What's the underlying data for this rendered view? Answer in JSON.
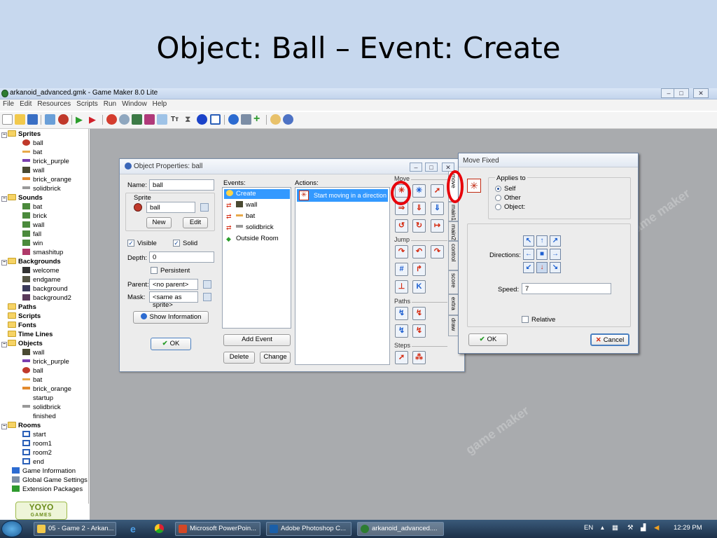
{
  "slide": {
    "title": "Object: Ball – Event: Create"
  },
  "window": {
    "title": "arkanoid_advanced.gmk - Game Maker 8.0 Lite",
    "menus": [
      "File",
      "Edit",
      "Resources",
      "Scripts",
      "Run",
      "Window",
      "Help"
    ],
    "controls": [
      "minimize",
      "maximize",
      "close"
    ]
  },
  "toolbar": {
    "icons": [
      "new-file-icon",
      "open-folder-icon",
      "save-icon",
      "create-exe-icon",
      "publish-icon",
      "run-icon",
      "run-debug-icon",
      "add-sprite-icon",
      "add-sound-icon",
      "add-background-icon",
      "add-path-icon",
      "add-script-icon",
      "add-font-icon",
      "add-timeline-icon",
      "add-object-icon",
      "add-room-icon",
      "game-information-icon",
      "global-settings-icon",
      "extension-packages-icon",
      "manual-icon",
      "help-icon"
    ]
  },
  "tree": {
    "sprites": {
      "label": "Sprites",
      "items": [
        "ball",
        "bat",
        "brick_purple",
        "wall",
        "brick_orange",
        "solidbrick"
      ]
    },
    "sounds": {
      "label": "Sounds",
      "items": [
        "bat",
        "brick",
        "wall",
        "fall",
        "win",
        "smashitup"
      ]
    },
    "backgrounds": {
      "label": "Backgrounds",
      "items": [
        "welcome",
        "endgame",
        "background",
        "background2"
      ]
    },
    "paths": "Paths",
    "scripts": "Scripts",
    "fonts": "Fonts",
    "timelines": "Time Lines",
    "objects": {
      "label": "Objects",
      "items": [
        "wall",
        "brick_purple",
        "ball",
        "bat",
        "brick_orange",
        "startup",
        "solidbrick",
        "finished"
      ]
    },
    "rooms": {
      "label": "Rooms",
      "items": [
        "start",
        "room1",
        "room2",
        "end"
      ]
    },
    "extras": [
      "Game Information",
      "Global Game Settings",
      "Extension Packages"
    ]
  },
  "logo": {
    "main": "YOYO",
    "sub": "GAMES"
  },
  "object_properties": {
    "title": "Object Properties: ball",
    "name_label": "Name:",
    "name_value": "ball",
    "sprite_label": "Sprite",
    "sprite_value": "ball",
    "new_button": "New",
    "edit_button": "Edit",
    "visible_label": "Visible",
    "visible_checked": true,
    "solid_label": "Solid",
    "solid_checked": true,
    "depth_label": "Depth:",
    "depth_value": "0",
    "persistent_label": "Persistent",
    "persistent_checked": false,
    "parent_label": "Parent:",
    "parent_value": "<no parent>",
    "mask_label": "Mask:",
    "mask_value": "<same as sprite>",
    "show_info_button": "Show Information",
    "ok_button": "OK",
    "events_label": "Events:",
    "events": [
      "Create",
      "wall",
      "bat",
      "solidbrick",
      "Outside Room"
    ],
    "selected_event": "Create",
    "add_event_button": "Add Event",
    "delete_button": "Delete",
    "change_button": "Change",
    "actions_label": "Actions:",
    "actions": [
      "Start moving in a direction"
    ]
  },
  "palette": {
    "groups": [
      "Move",
      "Jump",
      "Paths",
      "Steps"
    ],
    "tabs": [
      "move",
      "main1",
      "main2",
      "control",
      "score",
      "extra",
      "draw"
    ],
    "active_tab": "move"
  },
  "move_fixed": {
    "title": "Move Fixed",
    "applies_to_label": "Applies to",
    "applies_options": [
      "Self",
      "Other",
      "Object:"
    ],
    "applies_selected": "Self",
    "directions_label": "Directions:",
    "selected_directions": [
      "down"
    ],
    "speed_label": "Speed:",
    "speed_value": "7",
    "relative_label": "Relative",
    "relative_checked": false,
    "ok_button": "OK",
    "cancel_button": "Cancel"
  },
  "taskbar": {
    "tasks": [
      "05 - Game 2 - Arkan...",
      "Microsoft PowerPoin...",
      "Adobe Photoshop C...",
      "arkanoid_advanced...."
    ],
    "language": "EN",
    "time": "12:29 PM"
  },
  "colors": {
    "slide_banner": "#c7d8ee",
    "workspace": "#a9abae",
    "selection": "#3399ff",
    "highlight_circle": "#e8000a"
  }
}
